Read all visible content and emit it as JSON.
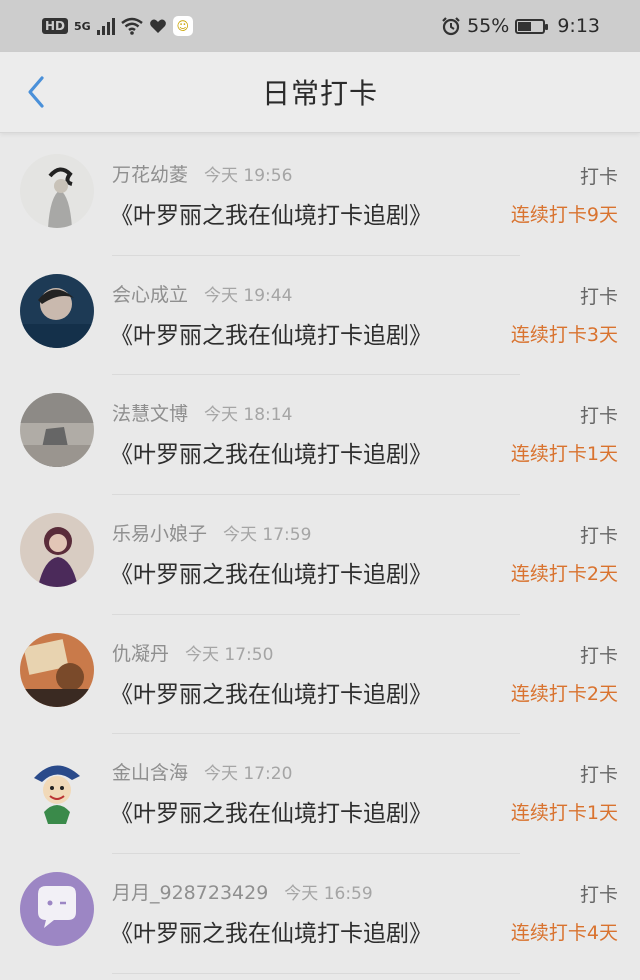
{
  "status_bar": {
    "hd": "HD",
    "network": "5G",
    "battery_percent": "55%",
    "battery_level": 0.55,
    "time": "9:13",
    "icons": [
      "signal-icon",
      "wifi-icon",
      "heart-icon",
      "app-notification-icon",
      "alarm-icon",
      "battery-icon"
    ]
  },
  "header": {
    "title": "日常打卡",
    "back_icon": "chevron-left-icon",
    "accent_color": "#4a90d9"
  },
  "colors": {
    "streak": "#d9732f",
    "background": "#e9e9e9"
  },
  "entries": [
    {
      "name": "万花幼菱",
      "time": "今天 19:56",
      "book": "《叶罗丽之我在仙境打卡追剧》",
      "action": "打卡",
      "streak": "连续打卡9天"
    },
    {
      "name": "会心成立",
      "time": "今天 19:44",
      "book": "《叶罗丽之我在仙境打卡追剧》",
      "action": "打卡",
      "streak": "连续打卡3天"
    },
    {
      "name": "法慧文博",
      "time": "今天 18:14",
      "book": "《叶罗丽之我在仙境打卡追剧》",
      "action": "打卡",
      "streak": "连续打卡1天"
    },
    {
      "name": "乐易小娘子",
      "time": "今天 17:59",
      "book": "《叶罗丽之我在仙境打卡追剧》",
      "action": "打卡",
      "streak": "连续打卡2天"
    },
    {
      "name": "仇凝丹",
      "time": "今天 17:50",
      "book": "《叶罗丽之我在仙境打卡追剧》",
      "action": "打卡",
      "streak": "连续打卡2天"
    },
    {
      "name": "金山含海",
      "time": "今天 17:20",
      "book": "《叶罗丽之我在仙境打卡追剧》",
      "action": "打卡",
      "streak": "连续打卡1天"
    },
    {
      "name": "月月_928723429",
      "time": "今天 16:59",
      "book": "《叶罗丽之我在仙境打卡追剧》",
      "action": "打卡",
      "streak": "连续打卡4天"
    }
  ]
}
